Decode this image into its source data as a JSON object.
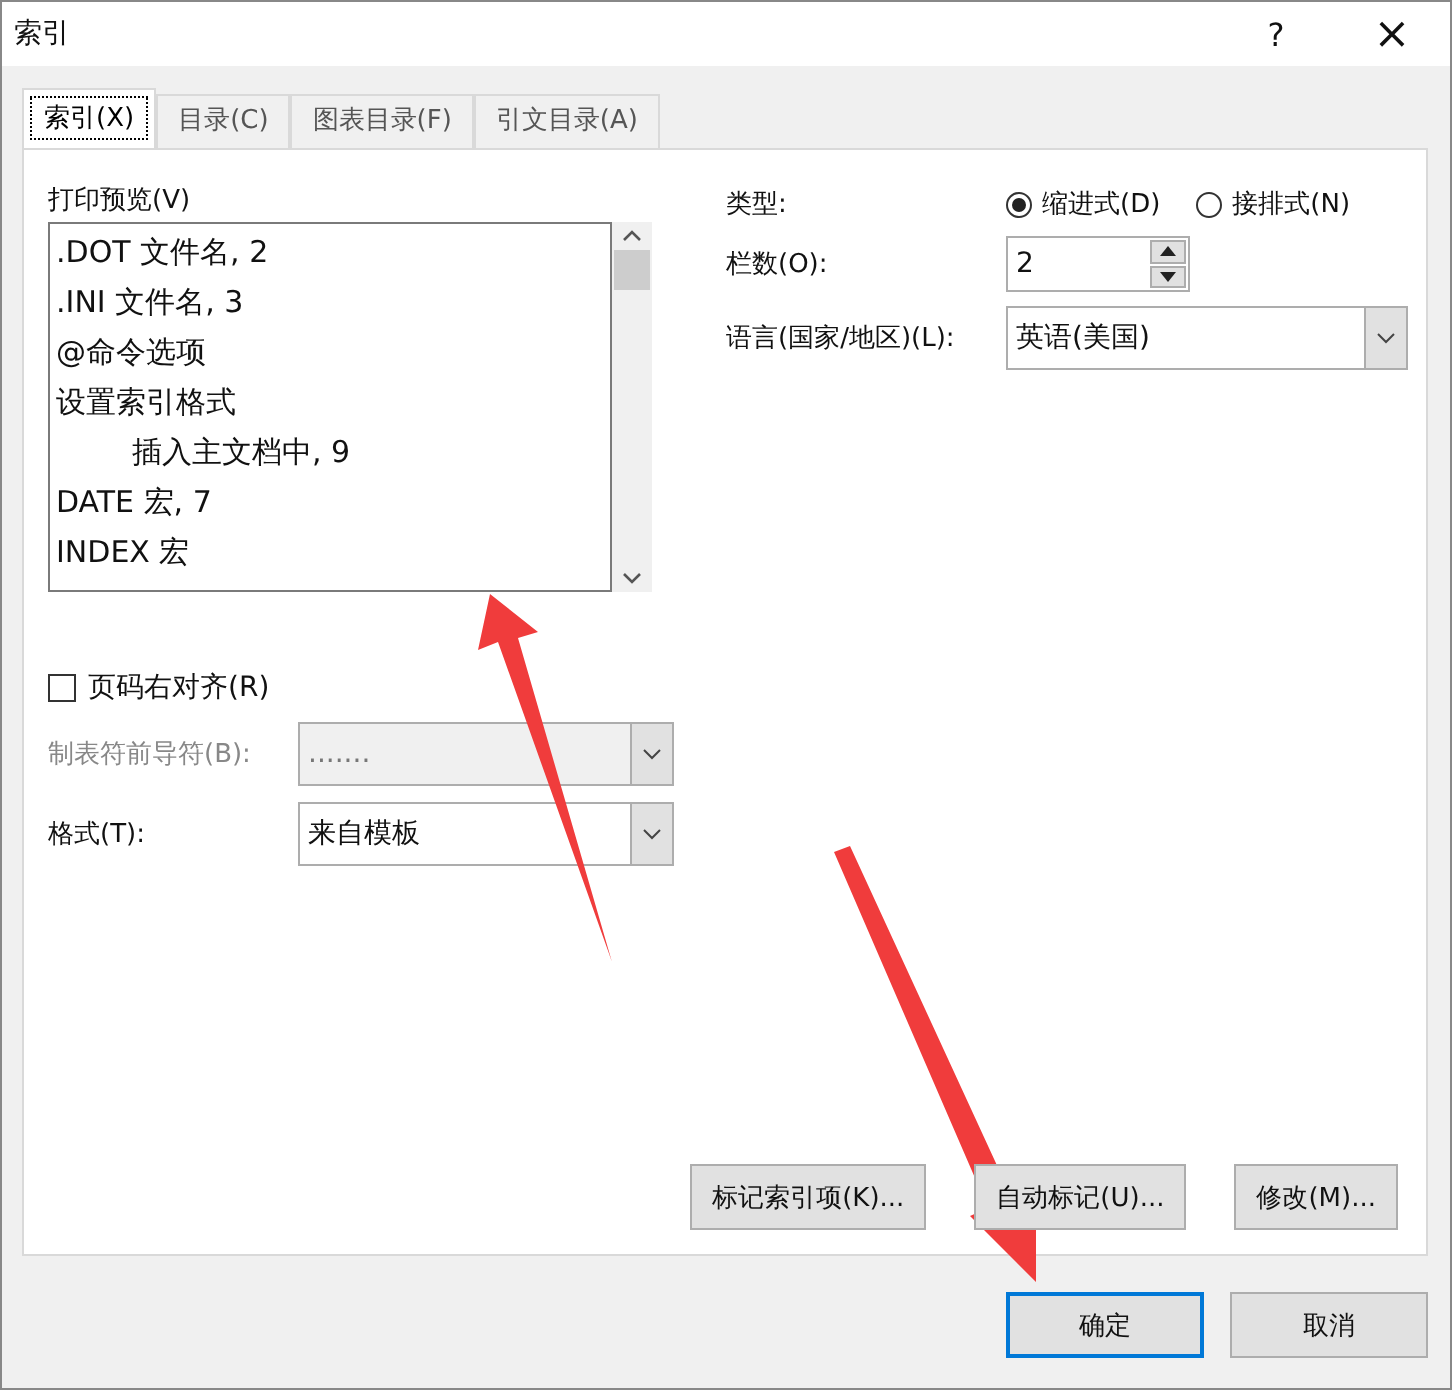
{
  "window": {
    "title": "索引",
    "help": "?",
    "close": "×"
  },
  "tabs": [
    {
      "label": "索引(X)",
      "selected": true
    },
    {
      "label": "目录(C)",
      "selected": false
    },
    {
      "label": "图表目录(F)",
      "selected": false
    },
    {
      "label": "引文目录(A)",
      "selected": false
    }
  ],
  "preview": {
    "label": "打印预览(V)",
    "lines": [
      {
        "text": ".DOT  文件名, 2"
      },
      {
        "text": ".INI  文件名, 3"
      },
      {
        "text": "@命令选项"
      },
      {
        "text": "设置索引格式",
        "children": [
          {
            "text": "插入主文档中, 9"
          }
        ]
      },
      {
        "text": "DATE  宏, 7"
      },
      {
        "text": "INDEX  宏"
      }
    ]
  },
  "type": {
    "label": "类型:",
    "options": [
      {
        "label": "缩进式(D)",
        "selected": true
      },
      {
        "label": "接排式(N)",
        "selected": false
      }
    ]
  },
  "columns": {
    "label": "栏数(O):",
    "value": "2"
  },
  "language": {
    "label": "语言(国家/地区)(L):",
    "value": "英语(美国)"
  },
  "right_align": {
    "label": "页码右对齐(R)",
    "checked": false
  },
  "tab_leader": {
    "label": "制表符前导符(B):",
    "value": ".......",
    "disabled": true
  },
  "format": {
    "label": "格式(T):",
    "value": "来自模板",
    "disabled": false
  },
  "action_buttons": [
    "标记索引项(K)...",
    "自动标记(U)...",
    "修改(M)..."
  ],
  "dialog_buttons": [
    {
      "label": "确定",
      "default": true
    },
    {
      "label": "取消",
      "default": false
    }
  ]
}
